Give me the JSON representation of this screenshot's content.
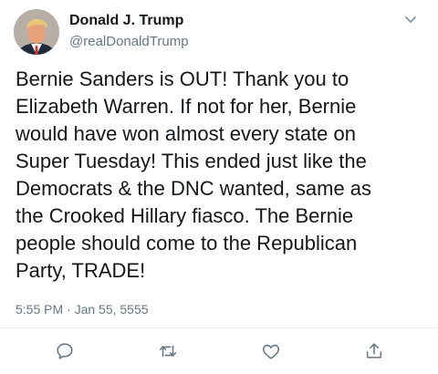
{
  "author": {
    "display_name": "Donald J. Trump",
    "handle": "@realDonaldTrump",
    "avatar": "avatar-photo"
  },
  "tweet": {
    "text": "Bernie Sanders is OUT! Thank you to\nElizabeth Warren. If not for her, Bernie\nwould have won almost every state on\nSuper Tuesday! This ended just like the\nDemocrats & the DNC wanted, same as\nthe Crooked Hillary fiasco. The Bernie\npeople should come to the Republican\nParty, TRADE!",
    "timestamp": "5:55 PM · Jan 55, 5555"
  },
  "menu": {
    "icon": "chevron-down-icon"
  },
  "actions": [
    {
      "name": "reply",
      "icon": "reply-icon"
    },
    {
      "name": "retweet",
      "icon": "retweet-icon"
    },
    {
      "name": "like",
      "icon": "heart-icon"
    },
    {
      "name": "share",
      "icon": "share-icon"
    }
  ],
  "colors": {
    "text": "#14171a",
    "secondary": "#657786",
    "icon": "#657786",
    "divider": "#e6ecf0"
  }
}
